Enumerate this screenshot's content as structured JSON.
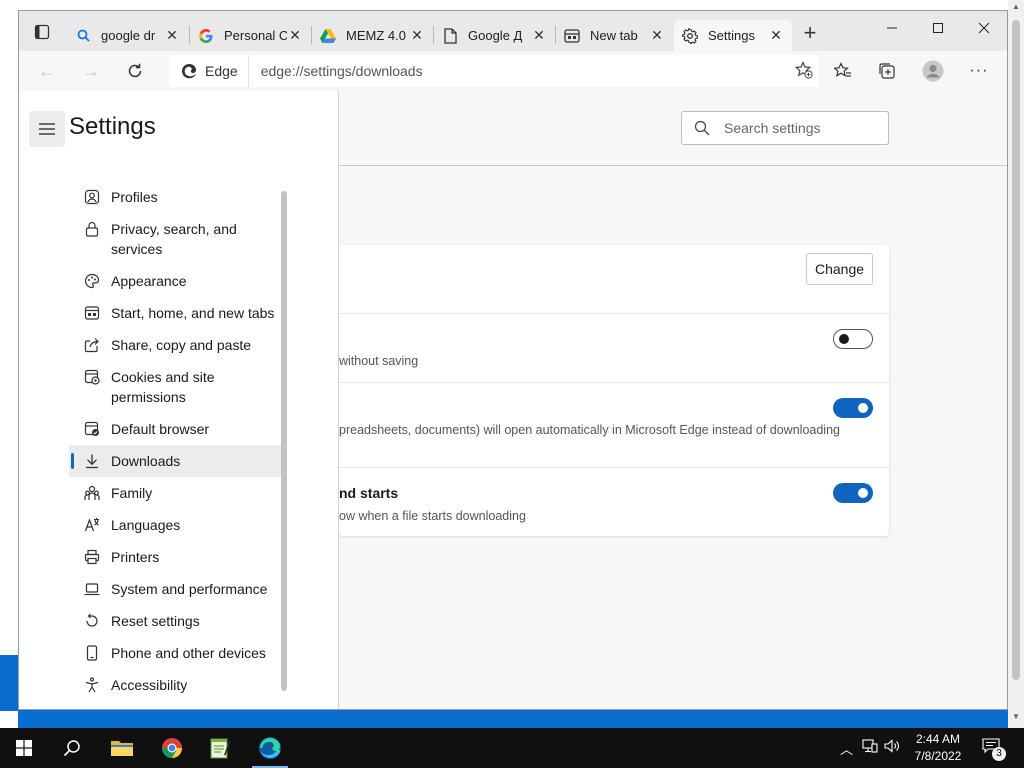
{
  "tabs": [
    {
      "title": "google dr",
      "icon": "search-icon"
    },
    {
      "title": "Personal C",
      "icon": "google-g-icon"
    },
    {
      "title": "MEMZ 4.0",
      "icon": "google-drive-icon"
    },
    {
      "title": "Google Д",
      "icon": "document-icon"
    },
    {
      "title": "New tab",
      "icon": "new-tab-icon"
    },
    {
      "title": "Settings",
      "icon": "gear-icon",
      "active": true
    }
  ],
  "address": {
    "site_label": "Edge",
    "url": "edge://settings/downloads"
  },
  "sidebar": {
    "title": "Settings",
    "items": [
      {
        "label": "Profiles",
        "icon": "profile-icon"
      },
      {
        "label": "Privacy, search, and services",
        "icon": "lock-icon"
      },
      {
        "label": "Appearance",
        "icon": "palette-icon"
      },
      {
        "label": "Start, home, and new tabs",
        "icon": "home-tabs-icon"
      },
      {
        "label": "Share, copy and paste",
        "icon": "share-icon"
      },
      {
        "label": "Cookies and site permissions",
        "icon": "cookies-icon"
      },
      {
        "label": "Default browser",
        "icon": "default-browser-icon"
      },
      {
        "label": "Downloads",
        "icon": "download-icon",
        "active": true
      },
      {
        "label": "Family",
        "icon": "family-icon"
      },
      {
        "label": "Languages",
        "icon": "languages-icon"
      },
      {
        "label": "Printers",
        "icon": "printer-icon"
      },
      {
        "label": "System and performance",
        "icon": "laptop-icon"
      },
      {
        "label": "Reset settings",
        "icon": "reset-icon"
      },
      {
        "label": "Phone and other devices",
        "icon": "phone-icon"
      },
      {
        "label": "Accessibility",
        "icon": "accessibility-icon"
      }
    ]
  },
  "search": {
    "placeholder": "Search settings"
  },
  "downloads": {
    "change_label": "Change",
    "rows": [
      {
        "title": "",
        "desc": "without saving",
        "toggle": "off"
      },
      {
        "title": "",
        "desc": "preadsheets, documents) will open automatically in Microsoft Edge instead of downloading",
        "toggle": "on"
      },
      {
        "title": "nd starts",
        "desc": "ow when a file starts downloading",
        "toggle": "on"
      }
    ]
  },
  "taskbar": {
    "time": "2:44 AM",
    "date": "7/8/2022",
    "notifications": "3"
  },
  "colors": {
    "accent": "#0f6cbd",
    "toggle_on": "#1064bd",
    "taskbar": "#101010",
    "desktop_blue": "#0a6ed1"
  }
}
